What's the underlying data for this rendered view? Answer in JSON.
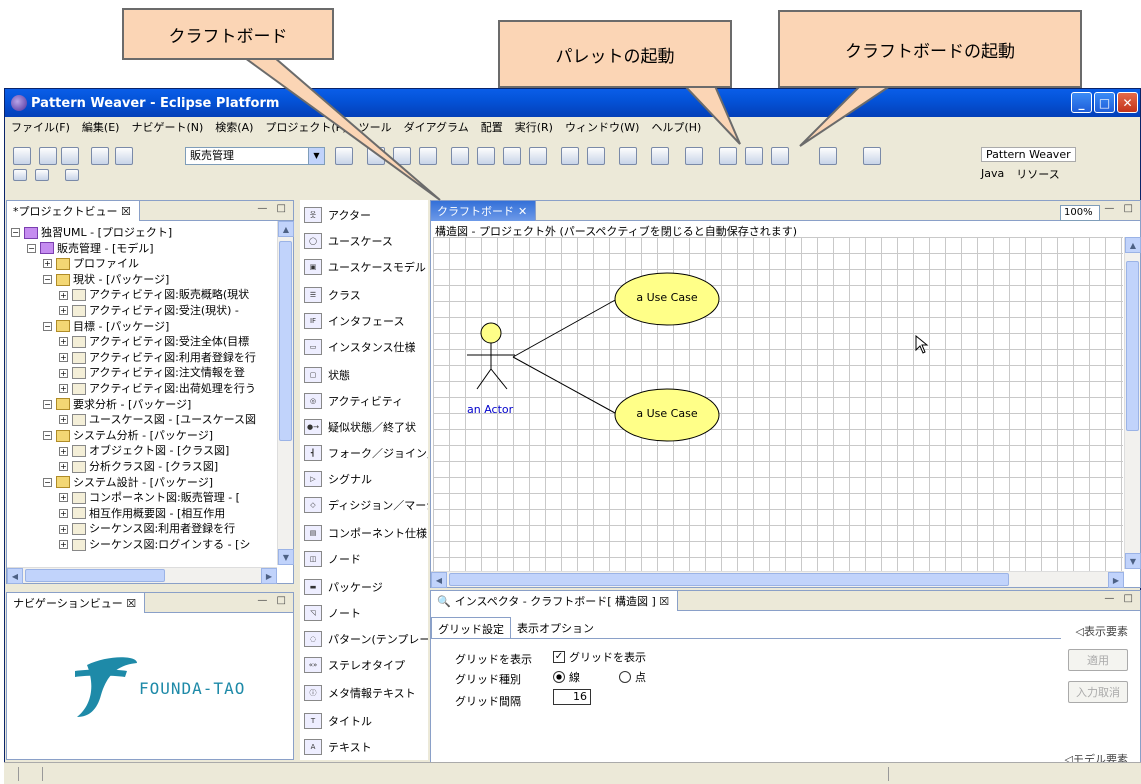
{
  "callouts": [
    {
      "label": "クラフトボード"
    },
    {
      "label": "パレットの起動"
    },
    {
      "label": "クラフトボードの起動"
    }
  ],
  "window": {
    "title": "Pattern Weaver - Eclipse Platform"
  },
  "menu": [
    "ファイル(F)",
    "編集(E)",
    "ナビゲート(N)",
    "検索(A)",
    "プロジェクト(P)",
    "ツール",
    "ダイアグラム",
    "配置",
    "実行(R)",
    "ウィンドウ(W)",
    "ヘルプ(H)"
  ],
  "toolbar": {
    "combo_value": "販売管理"
  },
  "perspectives": {
    "pattern_weaver": "Pattern Weaver",
    "java": "Java",
    "resource": "リソース"
  },
  "project_view": {
    "title": "*プロジェクトビュー ☒",
    "items": [
      {
        "label": "独習UML - [プロジェクト]"
      },
      {
        "label": "販売管理 - [モデル]"
      },
      {
        "label": "プロファイル"
      },
      {
        "label": "現状 - [パッケージ]"
      },
      {
        "label": "アクティビティ図:販売概略(現状"
      },
      {
        "label": "アクティビティ図:受注(現状) -"
      },
      {
        "label": "目標 - [パッケージ]"
      },
      {
        "label": "アクティビティ図:受注全体(目標"
      },
      {
        "label": "アクティビティ図:利用者登録を行"
      },
      {
        "label": "アクティビティ図:注文情報を登"
      },
      {
        "label": "アクティビティ図:出荷処理を行う"
      },
      {
        "label": "要求分析 - [パッケージ]"
      },
      {
        "label": "ユースケース図 - [ユースケース図"
      },
      {
        "label": "システム分析 - [パッケージ]"
      },
      {
        "label": "オブジェクト図 - [クラス図]"
      },
      {
        "label": "分析クラス図 - [クラス図]"
      },
      {
        "label": "システム設計 - [パッケージ]"
      },
      {
        "label": "コンポーネント図:販売管理 - ["
      },
      {
        "label": "相互作用概要図 - [相互作用"
      },
      {
        "label": "シーケンス図:利用者登録を行"
      },
      {
        "label": "シーケンス図:ログインする - [シ"
      }
    ]
  },
  "navigation_view": {
    "title": "ナビゲーションビュー ☒",
    "logo_text": "FOUNDA-TAO"
  },
  "palette": [
    {
      "label": "アクター",
      "icon": "actor-icon"
    },
    {
      "label": "ユースケース",
      "icon": "usecase-icon"
    },
    {
      "label": "ユースケースモデル",
      "icon": "usecase-model-icon"
    },
    {
      "label": "クラス",
      "icon": "class-icon"
    },
    {
      "label": "インタフェース",
      "icon": "interface-icon"
    },
    {
      "label": "インスタンス仕様",
      "icon": "instance-icon"
    },
    {
      "label": "状態",
      "icon": "state-icon"
    },
    {
      "label": "アクティビティ",
      "icon": "activity-icon"
    },
    {
      "label": "疑似状態／終了状",
      "icon": "pseudostate-icon"
    },
    {
      "label": "フォーク／ジョイン／",
      "icon": "fork-icon"
    },
    {
      "label": "シグナル",
      "icon": "signal-icon"
    },
    {
      "label": "ディシジョン／マージ",
      "icon": "decision-icon"
    },
    {
      "label": "コンポーネント仕様",
      "icon": "component-icon"
    },
    {
      "label": "ノード",
      "icon": "node-icon"
    },
    {
      "label": "パッケージ",
      "icon": "package-icon"
    },
    {
      "label": "ノート",
      "icon": "note-icon"
    },
    {
      "label": "パターン(テンプレー",
      "icon": "pattern-icon"
    },
    {
      "label": "ステレオタイプ",
      "icon": "stereotype-icon"
    },
    {
      "label": "メタ情報テキスト",
      "icon": "meta-icon"
    },
    {
      "label": "タイトル",
      "icon": "title-icon"
    },
    {
      "label": "テキスト",
      "icon": "text-icon"
    }
  ],
  "editor": {
    "tab": "クラフトボード",
    "zoom": "100%",
    "header": "構造図 - プロジェクト外 (パースペクティブを閉じると自動保存されます)",
    "actor_label": "an Actor",
    "usecase1": "a Use Case",
    "usecase2": "a Use Case"
  },
  "inspector": {
    "title": "インスペクタ - クラフトボード[ 構造図 ] ☒",
    "tab_grid": "グリッド設定",
    "tab_display": "表示オプション",
    "show_grid_label": "グリッドを表示",
    "show_grid_checkbox": "グリッドを表示",
    "grid_type_label": "グリッド種別",
    "grid_type_line": "線",
    "grid_type_point": "点",
    "grid_interval_label": "グリッド間隔",
    "grid_interval_value": "16",
    "display_elements": "◁表示要素",
    "model_elements": "◁モデル要素",
    "apply": "適用",
    "cancel": "入力取消"
  }
}
